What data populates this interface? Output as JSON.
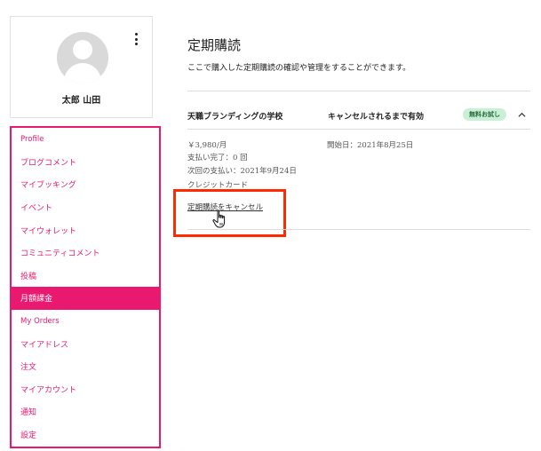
{
  "profile": {
    "name": "太郎 山田",
    "avatar_icon": "user-avatar-icon",
    "menu_icon": "kebab-menu-icon"
  },
  "sidebar": {
    "items": [
      {
        "label": "Profile",
        "type": "section"
      },
      {
        "label": "ブログコメント",
        "type": "link"
      },
      {
        "label": "マイブッキング",
        "type": "link"
      },
      {
        "label": "イベント",
        "type": "link"
      },
      {
        "label": "マイウォレット",
        "type": "link"
      },
      {
        "label": "コミュニティコメント",
        "type": "link"
      },
      {
        "label": "投稿",
        "type": "link"
      },
      {
        "label": "月額課金",
        "type": "active"
      },
      {
        "label": "My Orders",
        "type": "section"
      },
      {
        "label": "マイアドレス",
        "type": "link"
      },
      {
        "label": "注文",
        "type": "link"
      },
      {
        "label": "マイアカウント",
        "type": "link"
      },
      {
        "label": "通知",
        "type": "link"
      },
      {
        "label": "設定",
        "type": "link"
      }
    ]
  },
  "main": {
    "title": "定期購読",
    "description": "ここで購入した定期購読の確認や管理をすることができます。",
    "subscription": {
      "plan_name": "天職ブランディングの学校",
      "status": "キャンセルされるまで有効",
      "badge": "無料お試し",
      "price": "￥3,980/月",
      "payments_completed": "支払い完了：0 回",
      "next_payment": "次回の支払い：2021年9月24日",
      "payment_method": "クレジットカード",
      "start_date": "開始日：2021年8月25日",
      "cancel_label": "定期購読をキャンセル"
    }
  },
  "colors": {
    "accent": "#e8196e",
    "highlight_box": "#ff2a00",
    "badge_bg": "#c9efd5",
    "badge_text": "#2a6a3e"
  }
}
